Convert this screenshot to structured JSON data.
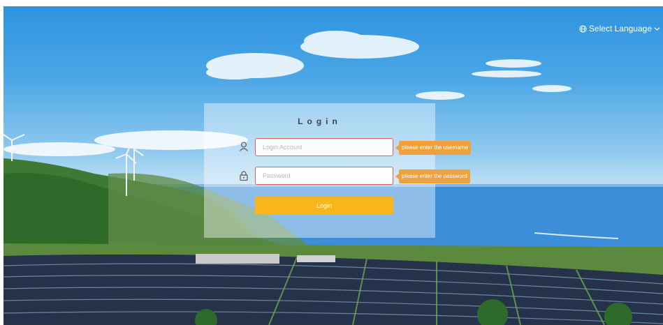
{
  "header": {
    "language_label": "Select Language",
    "globe_icon": "globe-icon",
    "chevron_icon": "chevron-down-icon"
  },
  "login": {
    "title": "Login",
    "username": {
      "placeholder": "Login Account",
      "value": "",
      "error": "please enter the username",
      "icon": "user-icon"
    },
    "password": {
      "placeholder": "Password",
      "value": "",
      "error": "please enter the password",
      "icon": "lock-icon"
    },
    "submit_label": "Login"
  },
  "colors": {
    "button": "#f8b51c",
    "error_tip": "#f0a03c",
    "error_border": "#e05a5a",
    "sky": "#2f93df",
    "sea": "#3d8ed8"
  }
}
